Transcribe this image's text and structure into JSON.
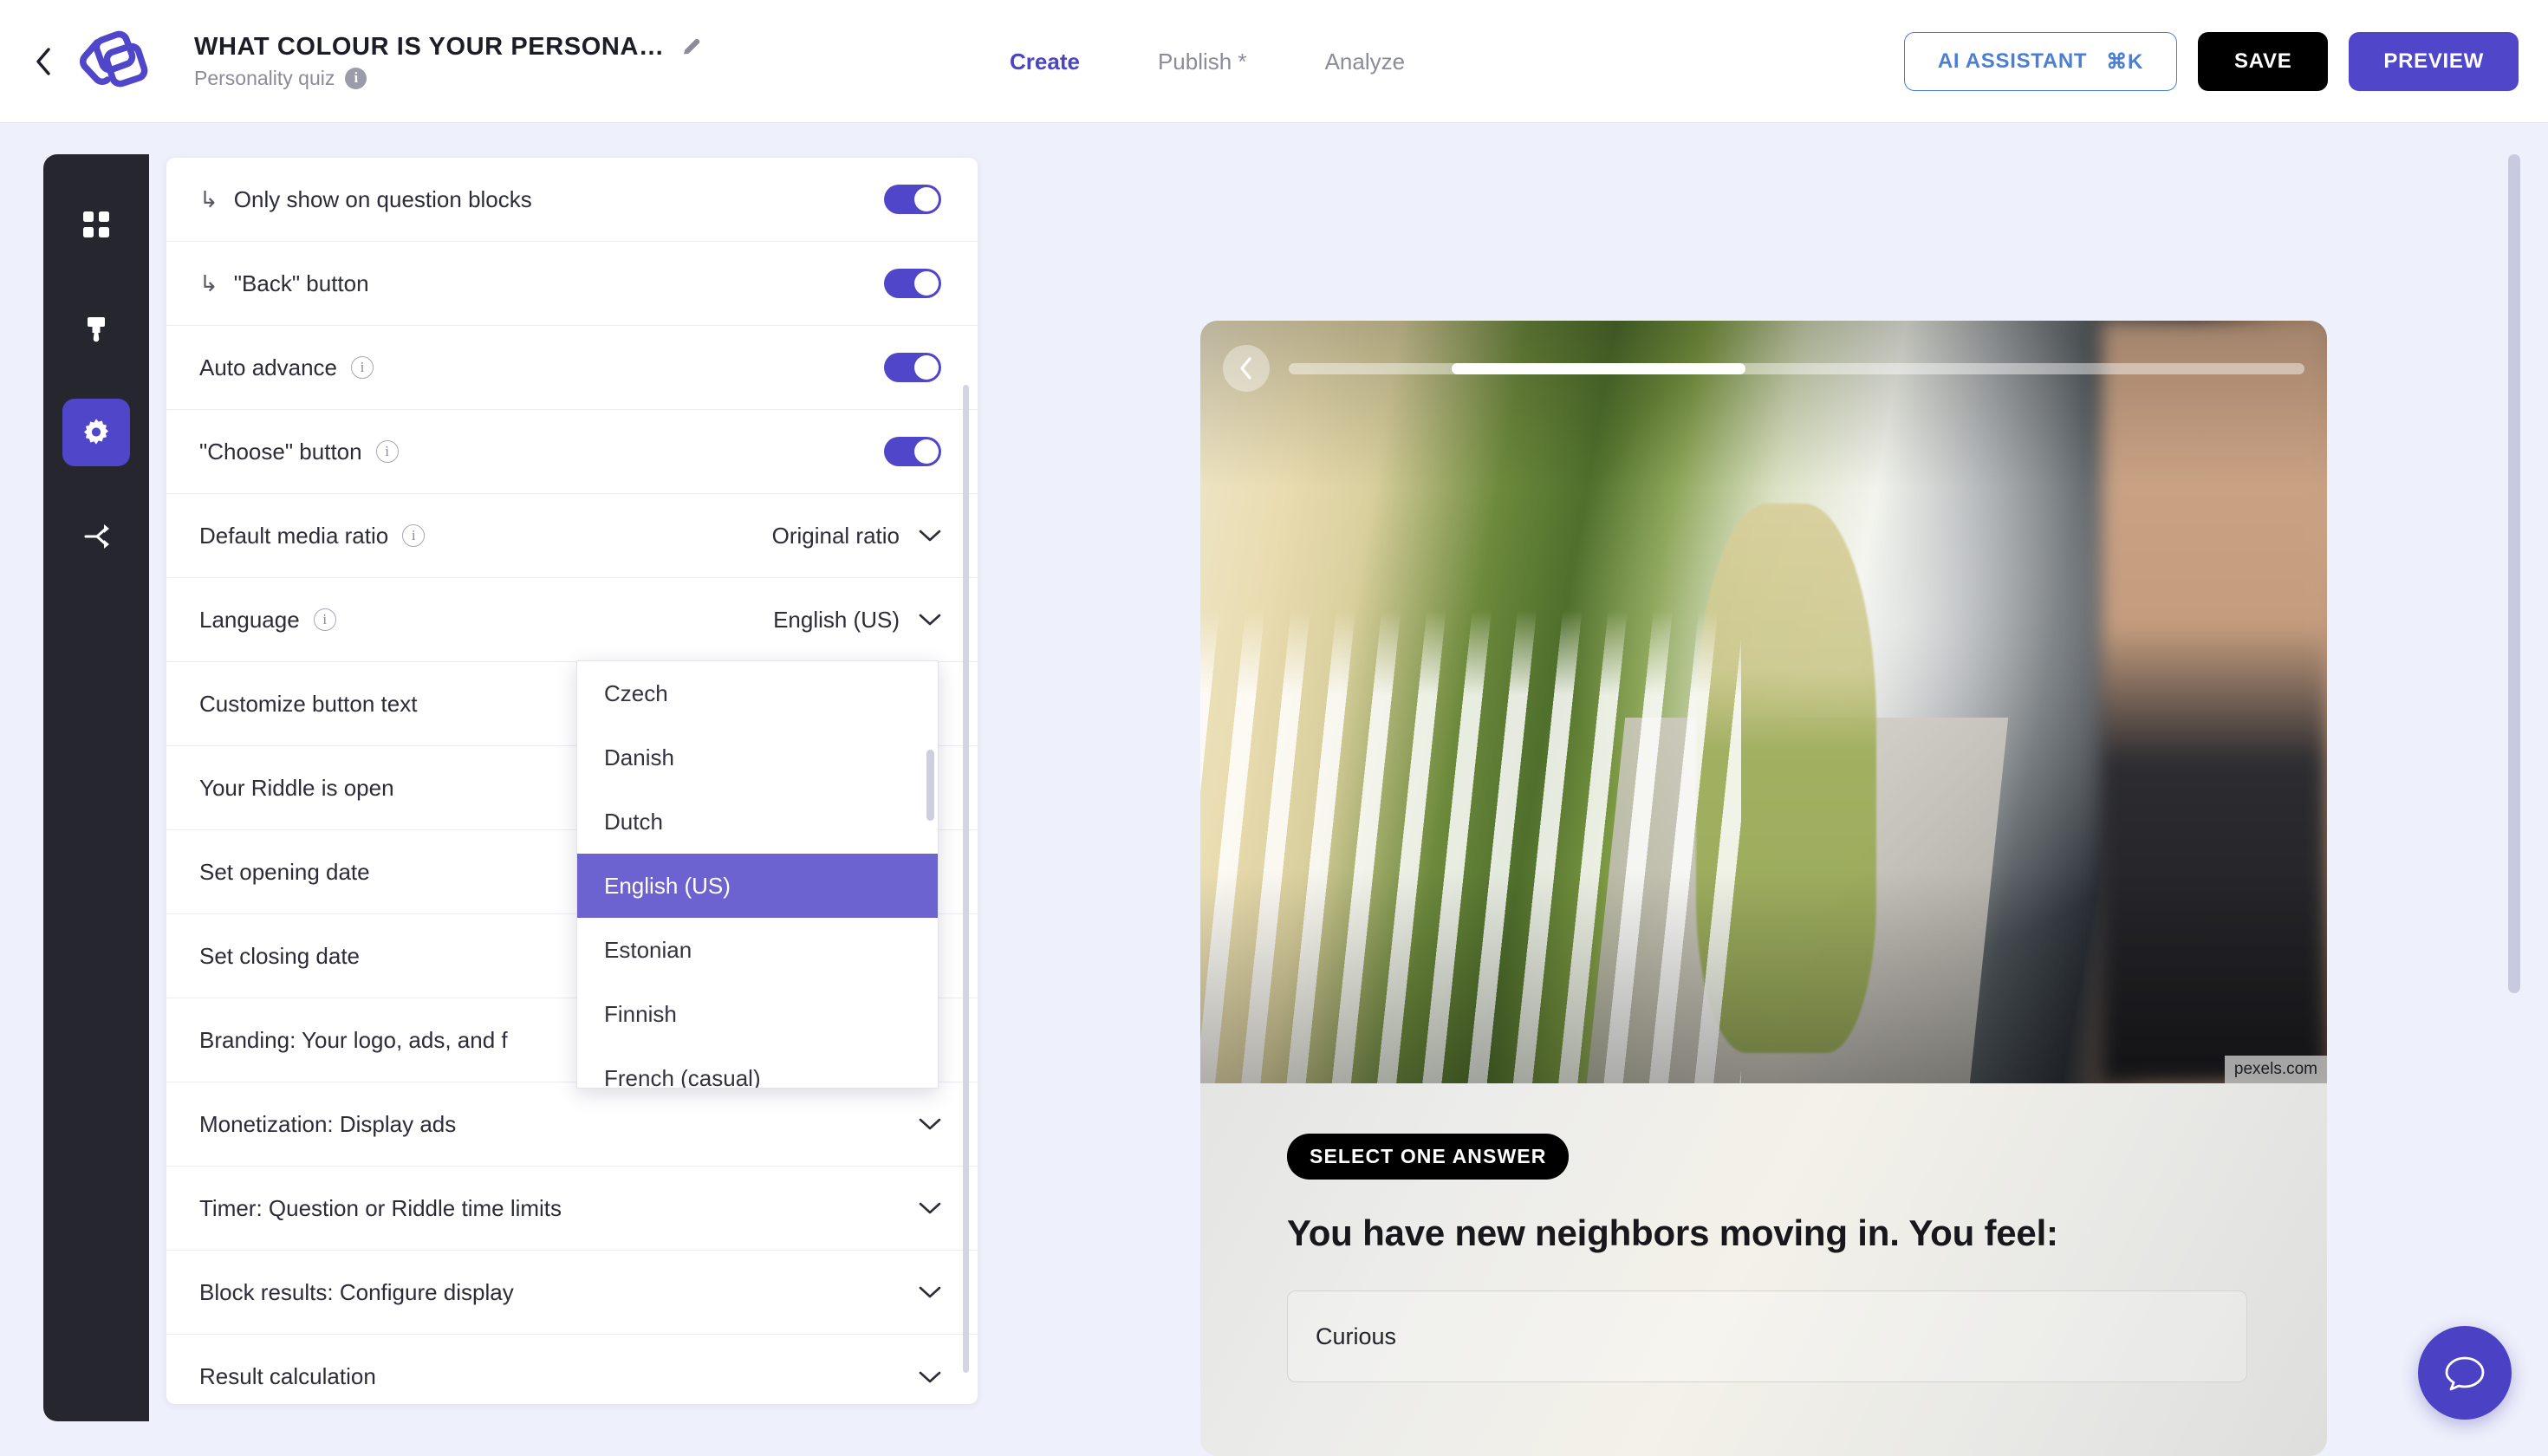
{
  "header": {
    "title": "WHAT COLOUR IS YOUR PERSONA…",
    "subtitle": "Personality quiz",
    "info_glyph": "i",
    "edit_icon": "pencil-icon",
    "back_icon": "chevron-left-icon",
    "logo_icon": "riddle-logo-icon",
    "tabs": [
      {
        "label": "Create",
        "active": true
      },
      {
        "label": "Publish *",
        "active": false
      },
      {
        "label": "Analyze",
        "active": false
      }
    ],
    "actions": {
      "ai_assistant": "AI ASSISTANT",
      "ai_shortcut": "⌘K",
      "save": "SAVE",
      "preview": "PREVIEW"
    }
  },
  "rail": {
    "items": [
      {
        "icon": "grid-icon",
        "active": false
      },
      {
        "icon": "brush-icon",
        "active": false
      },
      {
        "icon": "gear-icon",
        "active": true
      },
      {
        "icon": "share-icon",
        "active": false
      }
    ]
  },
  "settings": {
    "rows": [
      {
        "label": "Only show on question blocks",
        "sub": true,
        "info": false,
        "control": "toggle",
        "on": true
      },
      {
        "label": "\"Back\" button",
        "sub": true,
        "info": false,
        "control": "toggle",
        "on": true
      },
      {
        "label": "Auto advance",
        "sub": false,
        "info": true,
        "control": "toggle",
        "on": true
      },
      {
        "label": "\"Choose\" button",
        "sub": false,
        "info": true,
        "control": "toggle",
        "on": true
      },
      {
        "label": "Default media ratio",
        "sub": false,
        "info": true,
        "control": "select",
        "value": "Original ratio"
      },
      {
        "label": "Language",
        "sub": false,
        "info": true,
        "control": "select",
        "value": "English (US)"
      },
      {
        "label": "Customize button text",
        "sub": false,
        "info": false,
        "control": "none"
      },
      {
        "label": "Your Riddle is open",
        "sub": false,
        "info": false,
        "control": "none"
      },
      {
        "label": "Set opening date",
        "sub": false,
        "info": false,
        "control": "none"
      },
      {
        "label": "Set closing date",
        "sub": false,
        "info": false,
        "control": "none"
      },
      {
        "label": "Branding: Your logo, ads, and f",
        "sub": false,
        "info": false,
        "control": "none"
      },
      {
        "label": "Monetization: Display ads",
        "sub": false,
        "info": false,
        "control": "chevron"
      },
      {
        "label": "Timer: Question or Riddle time limits",
        "sub": false,
        "info": false,
        "control": "chevron"
      },
      {
        "label": "Block results: Configure display",
        "sub": false,
        "info": false,
        "control": "chevron"
      },
      {
        "label": "Result calculation",
        "sub": false,
        "info": false,
        "control": "chevron"
      }
    ]
  },
  "language_dropdown": {
    "selected": "English (US)",
    "options": [
      "Czech",
      "Danish",
      "Dutch",
      "English (US)",
      "Estonian",
      "Finnish",
      "French (casual)"
    ]
  },
  "preview": {
    "back_icon": "chevron-left-icon",
    "progress_percent": 29,
    "image_credit": "pexels.com",
    "badge": "SELECT ONE ANSWER",
    "question": "You have new neighbors moving in. You feel:",
    "answers": [
      "Curious"
    ]
  },
  "fab": {
    "icon": "chat-bubble-icon"
  },
  "colors": {
    "accent": "#4f46c9",
    "accent_soft": "#6c63d0",
    "rail_bg": "#26262f",
    "page_bg": "#eef0fb",
    "ai_blue": "#4a7fd4"
  }
}
